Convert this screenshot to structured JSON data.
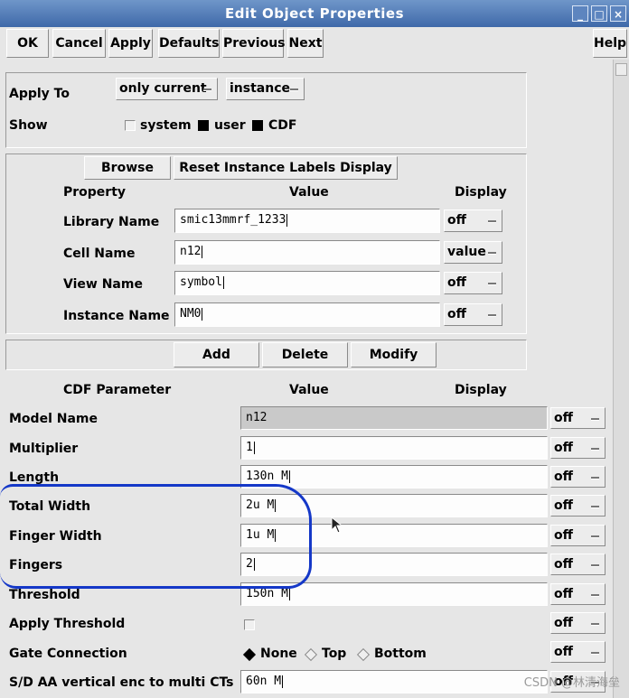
{
  "window": {
    "title": "Edit Object Properties"
  },
  "toolbar": {
    "ok": "OK",
    "cancel": "Cancel",
    "apply": "Apply",
    "defaults": "Defaults",
    "previous": "Previous",
    "next": "Next",
    "help": "Help"
  },
  "apply_to": {
    "label": "Apply To",
    "scope": "only current",
    "target": "instance"
  },
  "show": {
    "label": "Show",
    "system": "system",
    "user": "user",
    "cdf": "CDF"
  },
  "instance_panel": {
    "browse": "Browse",
    "reset": "Reset Instance Labels Display",
    "headers": {
      "property": "Property",
      "value": "Value",
      "display": "Display"
    },
    "rows": [
      {
        "name": "Library Name",
        "value": "smic13mmrf_1233",
        "display": "off"
      },
      {
        "name": "Cell Name",
        "value": "n12",
        "display": "value"
      },
      {
        "name": "View Name",
        "value": "symbol",
        "display": "off"
      },
      {
        "name": "Instance Name",
        "value": "NM0",
        "display": "off"
      }
    ],
    "add": "Add",
    "delete": "Delete",
    "modify": "Modify"
  },
  "cdf": {
    "headers": {
      "param": "CDF Parameter",
      "value": "Value",
      "display": "Display"
    },
    "rows": [
      {
        "name": "Model Name",
        "value": "n12",
        "display": "off"
      },
      {
        "name": "Multiplier",
        "value": "1",
        "display": "off"
      },
      {
        "name": "Length",
        "value": "130n M",
        "display": "off"
      },
      {
        "name": "Total Width",
        "value": "2u M",
        "display": "off"
      },
      {
        "name": "Finger Width",
        "value": "1u M",
        "display": "off"
      },
      {
        "name": "Fingers",
        "value": "2",
        "display": "off"
      },
      {
        "name": "Threshold",
        "value": "150n M",
        "display": "off"
      },
      {
        "name": "Apply Threshold",
        "display": "off"
      },
      {
        "name": "Gate Connection",
        "display": "off",
        "options": [
          "None",
          "Top",
          "Bottom"
        ]
      },
      {
        "name": "S/D AA vertical enc to multi CTs",
        "value": "60n M",
        "display": "off"
      }
    ]
  },
  "watermark": "CSDN @林清海垒"
}
